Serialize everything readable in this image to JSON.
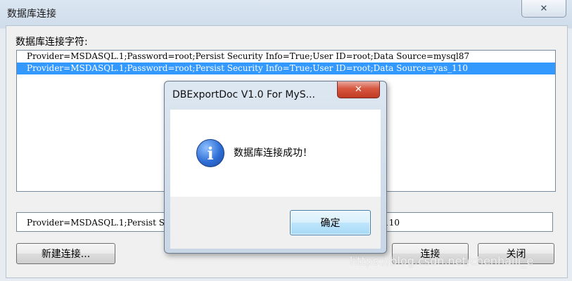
{
  "window": {
    "title": "数据库连接",
    "close_glyph": "✕",
    "connection_string_label": "数据库连接字符:",
    "list_items": [
      "Provider=MSDASQL.1;Password=root;Persist Security Info=True;User ID=root;Data Source=mysql87",
      "Provider=MSDASQL.1;Password=root;Persist Security Info=True;User ID=root;Data Source=yas_110"
    ],
    "selected_index": 1,
    "connection_input_value": "Provider=MSDASQL.1;Persist Security Info=True;User ID=root;Data Source=yas_110",
    "buttons": {
      "new_connection": "新建连接...",
      "connect": "连接",
      "close": "关闭"
    }
  },
  "message_box": {
    "title": "DBExportDoc V1.0 For MyS...",
    "close_glyph": "✕",
    "icon": "info-icon",
    "icon_glyph": "i",
    "message": "数据库连接成功！",
    "ok_label": "确定"
  },
  "watermark": "https://blog.csdn.net/chenhaili_e",
  "colors": {
    "selection": "#3399ff",
    "close_red": "#c13a23"
  }
}
